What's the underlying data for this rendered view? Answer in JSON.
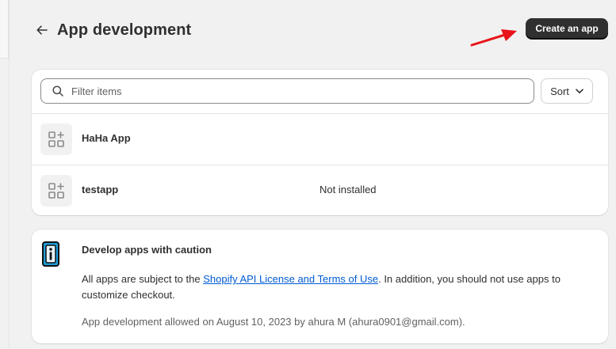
{
  "page": {
    "title": "App development",
    "create_button_label": "Create an app"
  },
  "filter": {
    "placeholder": "Filter items",
    "sort_label": "Sort"
  },
  "apps": [
    {
      "name": "HaHa App",
      "status": ""
    },
    {
      "name": "testapp",
      "status": "Not installed"
    }
  ],
  "caution": {
    "title": "Develop apps with caution",
    "body_before_link": "All apps are subject to the ",
    "link_text": "Shopify API License and Terms of Use",
    "body_after_link": ". In addition, you should not use apps to customize checkout.",
    "meta": "App development allowed on August 10, 2023 by ahura M (ahura0901@gmail.com)."
  },
  "colors": {
    "primary_button": "#303030",
    "link": "#005bd3",
    "annotation_arrow": "#e8141a",
    "info_icon_fill": "#1d9bd6"
  },
  "icons": [
    "arrow-left-icon",
    "search-icon",
    "chevron-down-icon",
    "app-grid-icon",
    "info-icon",
    "annotation-arrow"
  ]
}
